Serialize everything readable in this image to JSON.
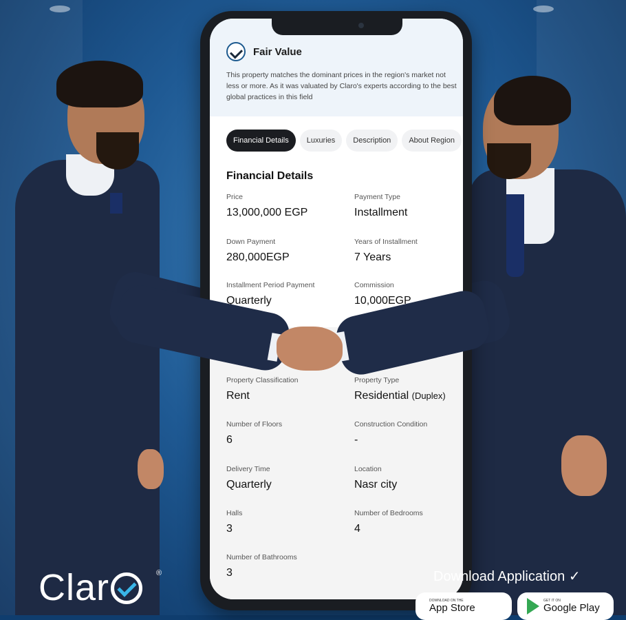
{
  "fair_value": {
    "title": "Fair Value",
    "description": "This property matches the dominant prices in the region's market not less or more. As it was valuated by Claro's experts according to the best global practices in this field"
  },
  "tabs": [
    "Financial Details",
    "Luxuries",
    "Description",
    "About Region"
  ],
  "section_title": "Financial Details",
  "fields": [
    {
      "label": "Price",
      "value": "13,000,000 EGP"
    },
    {
      "label": "Payment Type",
      "value": "Installment"
    },
    {
      "label": "Down Payment",
      "value": "280,000EGP"
    },
    {
      "label": "Years of Installment",
      "value": "7 Years"
    },
    {
      "label": "Installment Period Payment",
      "value": "Quarterly"
    },
    {
      "label": "Commission",
      "value": "10,000EGP"
    },
    {
      "label": "Property Classification",
      "value": "Rent"
    },
    {
      "label": "Property Type",
      "value": "Residential",
      "value_extra": "(Duplex)"
    },
    {
      "label": "Number of Floors",
      "value": "6"
    },
    {
      "label": "Construction Condition",
      "value": "-"
    },
    {
      "label": "Delivery Time",
      "value": "Quarterly"
    },
    {
      "label": "Location",
      "value": "Nasr city"
    },
    {
      "label": "Halls",
      "value": "3"
    },
    {
      "label": "Number of Bedrooms",
      "value": "4"
    },
    {
      "label": "Number of Bathrooms",
      "value": "3"
    }
  ],
  "brand": {
    "name_prefix": "Clar",
    "registered": "®"
  },
  "download": {
    "title": "Download Application",
    "check": "✓",
    "app_store": {
      "small": "DOWNLOAD ON THE",
      "big": "App Store",
      "icon": ""
    },
    "google_play": {
      "small": "GET IT ON",
      "big": "Google Play"
    }
  }
}
